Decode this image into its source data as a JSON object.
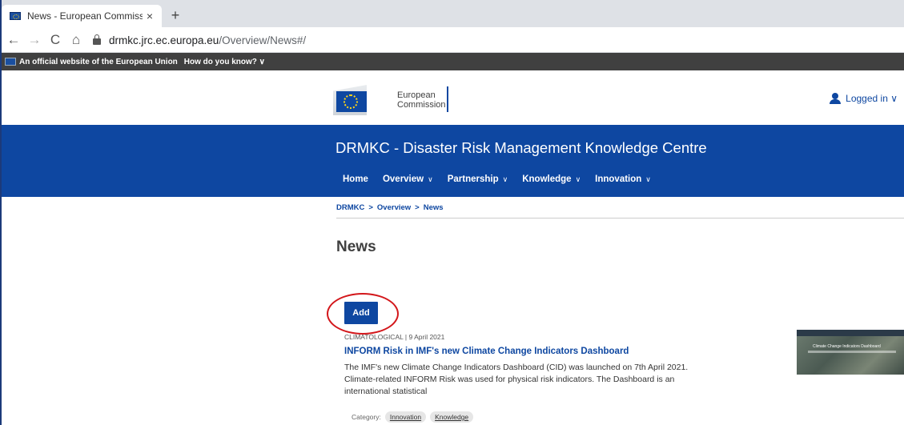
{
  "browser": {
    "tab_title": "News - European Commission",
    "tab_close": "×",
    "new_tab": "+",
    "nav": {
      "back": "←",
      "forward": "→",
      "reload": "C",
      "home": "⌂"
    },
    "url_host": "drmkc.jrc.ec.europa.eu",
    "url_path": "/Overview/News#/"
  },
  "eu_bar": {
    "official": "An official website of the European Union",
    "how": "How do you know? ∨"
  },
  "header": {
    "logo_text_line1": "European",
    "logo_text_line2": "Commission",
    "logged_in": "Logged in ∨"
  },
  "banner": {
    "site_title": "DRMKC - Disaster Risk Management Knowledge Centre",
    "nav": [
      {
        "label": "Home",
        "chevron": ""
      },
      {
        "label": "Overview",
        "chevron": "∨"
      },
      {
        "label": "Partnership",
        "chevron": "∨"
      },
      {
        "label": "Knowledge",
        "chevron": "∨"
      },
      {
        "label": "Innovation",
        "chevron": "∨"
      }
    ]
  },
  "breadcrumb": {
    "items": [
      "DRMKC",
      "Overview",
      "News"
    ],
    "sep": ">"
  },
  "page": {
    "title": "News",
    "add_label": "Add"
  },
  "news_item": {
    "meta": "CLIMATOLOGICAL | 9 April 2021",
    "title": "INFORM Risk in IMF's new Climate Change Indicators Dashboard",
    "description": "The IMF's new Climate Change Indicators Dashboard (CID) was launched on 7th April 2021. Climate-related INFORM Risk was used for physical risk indicators. The Dashboard is an international statistical",
    "category_label": "Category:",
    "tags": [
      "Innovation",
      "Knowledge"
    ],
    "thumb_title": "Climate Change Indicators Dashboard"
  },
  "colors": {
    "ec_blue": "#0e47a1",
    "eu_bar": "#404040",
    "annotation_red": "#d3171b"
  }
}
